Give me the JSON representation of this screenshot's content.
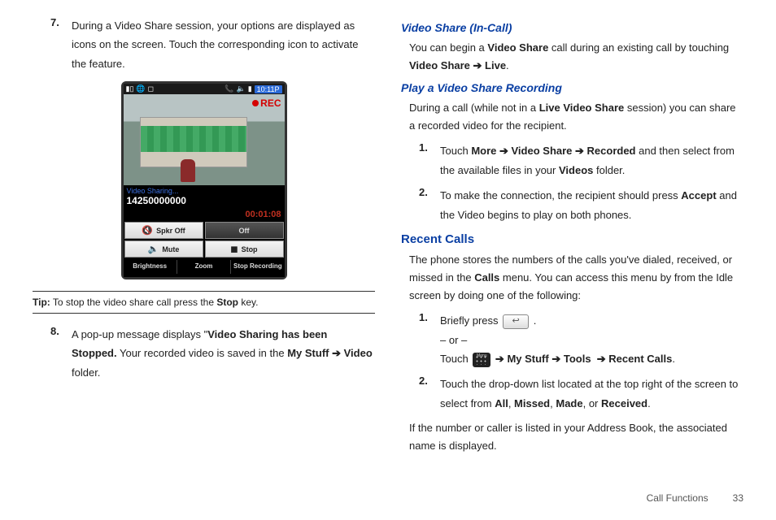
{
  "left": {
    "step7": {
      "num": "7.",
      "text_a": "During a Video Share session, your options are displayed as icons on the screen. Touch the corresponding icon to activate the feature."
    },
    "phone": {
      "time": "10:11P",
      "rec": "REC",
      "sharing_label": "Video Sharing...",
      "number": "14250000000",
      "timer": "00:01:08",
      "spkr": "Spkr Off",
      "off": "Off",
      "mute": "Mute",
      "stop": "Stop",
      "brightness": "Brightness",
      "zoom": "Zoom",
      "stop_rec": "Stop Recording"
    },
    "tip_label": "Tip:",
    "tip_text_a": " To stop the video share call press the ",
    "tip_bold": "Stop",
    "tip_text_b": " key.",
    "step8": {
      "num": "8.",
      "a": "A pop-up message displays \"",
      "b": "Video Sharing has been Stopped.",
      "c": " Your recorded video is saved in the ",
      "d": "My Stuff",
      "e": "Video",
      "f": " folder."
    }
  },
  "right": {
    "h1": "Video Share (In-Call)",
    "p1a": "You can begin a ",
    "p1b": "Video Share",
    "p1c": " call during an existing call by touching ",
    "p1d": "Video Share",
    "p1e": "Live",
    "p1f": ".",
    "h2": "Play a Video Share Recording",
    "p2a": "During a call (while not in a ",
    "p2b": "Live Video Share",
    "p2c": " session) you can share a recorded video for the recipient.",
    "s1": {
      "num": "1.",
      "a": "Touch ",
      "b": "More",
      "c": "Video Share",
      "d": "Recorded",
      "e": " and then select from the available files in your ",
      "f": "Videos",
      "g": " folder."
    },
    "s2": {
      "num": "2.",
      "a": "To make the connection, the recipient should press ",
      "b": "Accept",
      "c": " and the Video begins to play on both phones."
    },
    "h3": "Recent Calls",
    "p3a": "The phone stores the numbers of the calls you've dialed, received, or missed in the ",
    "p3b": "Calls",
    "p3c": " menu. You can access this menu by from the Idle screen by doing one of the following:",
    "rs1": {
      "num": "1.",
      "a": "Briefly press ",
      "b": " .",
      "or": "– or –",
      "c": "Touch ",
      "d": "My Stuff",
      "e": "Tools",
      "f": "Recent Calls",
      "g": "."
    },
    "rs2": {
      "num": "2.",
      "a": "Touch the drop-down list located at the top right of the screen to select from ",
      "b": "All",
      "c": ", ",
      "d": "Missed",
      "e": ", ",
      "f": "Made",
      "g": ", or ",
      "h": "Received",
      "i": "."
    },
    "p4": "If the number or caller is listed in your Address Book, the associated name is displayed."
  },
  "footer": {
    "section": "Call Functions",
    "page": "33"
  }
}
